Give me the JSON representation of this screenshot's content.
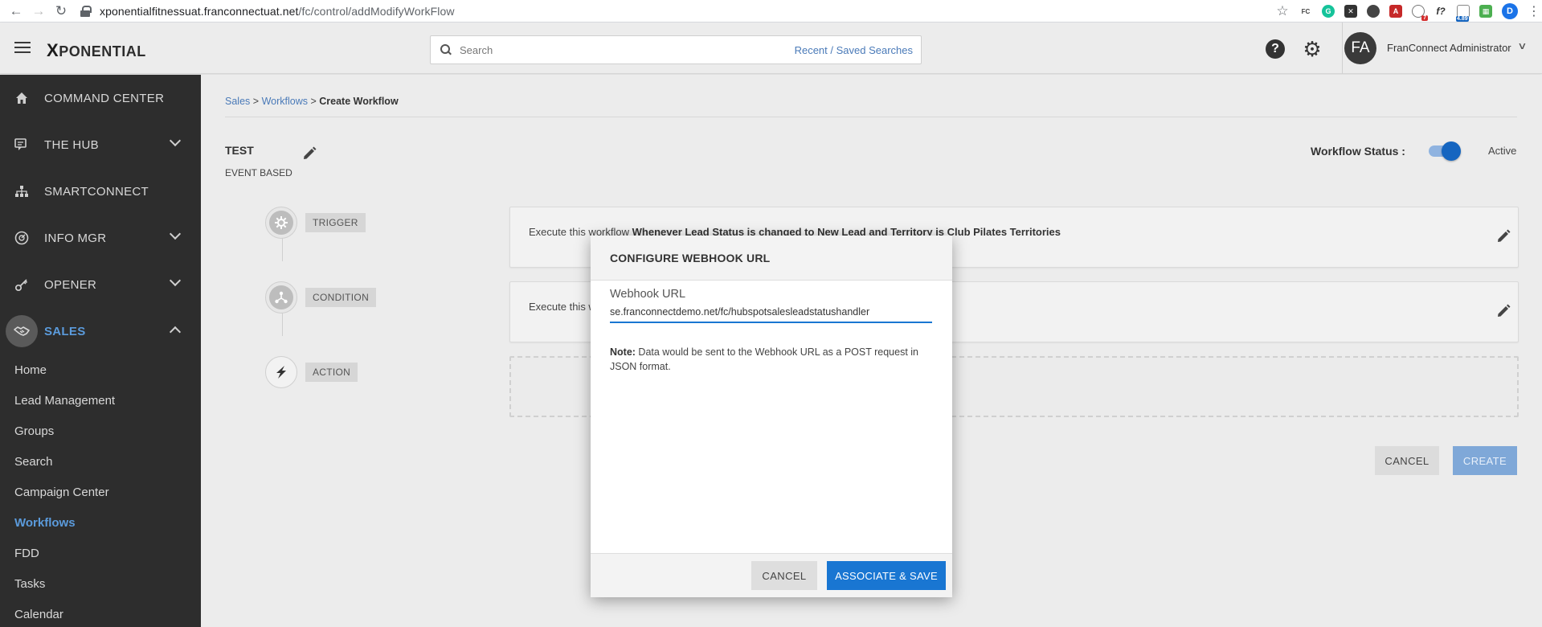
{
  "browser": {
    "url_host": "xponentialfitnessuat.franconnectuat.net",
    "url_path": "/fc/control/addModifyWorkFlow",
    "profile_initial": "D",
    "ext_badges": {
      "red": "7",
      "blue": "4.89"
    }
  },
  "header": {
    "brand": "PONENTIAL",
    "brand_x": "X",
    "search_placeholder": "Search",
    "recent_searches_label": "Recent / Saved Searches",
    "help_glyph": "?",
    "avatar_initials": "FA",
    "user_name": "FranConnect Administrator"
  },
  "sidebar": {
    "top_items": [
      {
        "label": "COMMAND CENTER",
        "icon": "home-icon"
      },
      {
        "label": "THE HUB",
        "icon": "chat-icon"
      },
      {
        "label": "SMARTCONNECT",
        "icon": "network-icon"
      },
      {
        "label": "INFO MGR",
        "icon": "info-icon"
      },
      {
        "label": "OPENER",
        "icon": "key-icon"
      },
      {
        "label": "SALES",
        "icon": "handshake-icon"
      }
    ],
    "sub_items": [
      {
        "label": "Home"
      },
      {
        "label": "Lead Management"
      },
      {
        "label": "Groups"
      },
      {
        "label": "Search"
      },
      {
        "label": "Campaign Center"
      },
      {
        "label": "Workflows"
      },
      {
        "label": "FDD"
      },
      {
        "label": "Tasks"
      },
      {
        "label": "Calendar"
      }
    ],
    "active_sub": "Workflows"
  },
  "breadcrumb": {
    "sales": "Sales",
    "workflows": "Workflows",
    "current": "Create Workflow",
    "sep": ">"
  },
  "workflow": {
    "name": "TEST",
    "type": "EVENT BASED",
    "status_label": "Workflow Status :",
    "status_value": "Active",
    "steps": [
      "TRIGGER",
      "CONDITION",
      "ACTION"
    ],
    "trigger_prefix": "Execute this workflow",
    "trigger_bold": "Whenever Lead Status is changed to New Lead and Territory is Club Pilates Territories",
    "condition_prefix": "Execute this w"
  },
  "buttons": {
    "cancel": "CANCEL",
    "create": "CREATE"
  },
  "modal": {
    "title": "CONFIGURE WEBHOOK URL",
    "field_label": "Webhook URL",
    "field_value": "se.franconnectdemo.net/fc/hubspotsalesleadstatushandler",
    "note_label": "Note:",
    "note_text": " Data would be sent to the Webhook URL as a POST request in JSON format.",
    "cancel_label": "CANCEL",
    "save_label": "ASSOCIATE & SAVE"
  },
  "colors": {
    "sidebar_bg": "#2d2d2d",
    "accent": "#1976d2",
    "link": "#4a7ab8",
    "active_nav": "#5b9bdc"
  }
}
